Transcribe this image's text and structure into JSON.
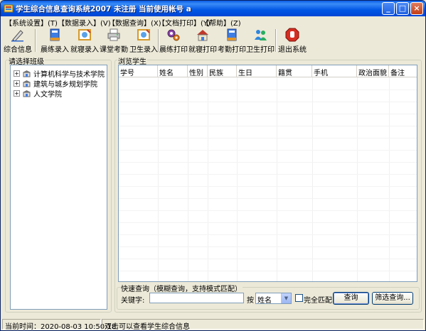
{
  "window": {
    "title": "学生综合信息查询系统2007 未注册  当前使用帐号 a",
    "min_label": "_",
    "max_label": "□",
    "close_label": "×"
  },
  "menu": [
    {
      "label": "【系统设置】(T)"
    },
    {
      "label": "【数据录入】(V)"
    },
    {
      "label": "【数据查询】(X)"
    },
    {
      "label": "【文档打印】(Y)"
    },
    {
      "label": "【帮助】(Z)"
    }
  ],
  "toolbar": {
    "items": [
      {
        "label": "综合信息",
        "icon": "pen-icon"
      },
      {
        "label": "晨练录入",
        "icon": "book-icon"
      },
      {
        "label": "就寝录入",
        "icon": "picture-icon"
      },
      {
        "label": "课堂考勤",
        "icon": "printer-icon"
      },
      {
        "label": "卫生录入",
        "icon": "picture-icon"
      },
      {
        "label": "晨练打印",
        "icon": "gears-icon"
      },
      {
        "label": "就寝打印",
        "icon": "house-icon"
      },
      {
        "label": "考勤打印",
        "icon": "book-icon"
      },
      {
        "label": "卫生打印",
        "icon": "people-icon"
      },
      {
        "label": "退出系统",
        "icon": "stop-hand-icon"
      }
    ]
  },
  "class_panel": {
    "title": "请选择班级",
    "nodes": [
      {
        "label": "计算机科学与技术学院",
        "expander": "+"
      },
      {
        "label": "建筑与城乡规划学院",
        "expander": "+"
      },
      {
        "label": "人文学院",
        "expander": "+"
      }
    ]
  },
  "students_panel": {
    "title": "浏览学生",
    "columns": [
      "学号",
      "姓名",
      "性别",
      "民族",
      "生日",
      "籍贯",
      "手机",
      "政治面貌",
      "备注"
    ]
  },
  "quick_search": {
    "title": "快速查询（模糊查询，支持模式匹配）",
    "keyword_label": "关键字:",
    "keyword_value": "",
    "by_label": "按",
    "field_selected": "姓名",
    "exact_match_label": "完全匹配",
    "exact_match_checked": false,
    "query_button": "查询",
    "filter_button": "筛选查询..."
  },
  "status": {
    "time": "当前时间：2020-08-03 10:50:18",
    "hint": "双击可以查看学生综合信息"
  },
  "colors": {
    "title_bar": "#0055e5",
    "face": "#ece9d8",
    "border": "#7f9db9"
  }
}
